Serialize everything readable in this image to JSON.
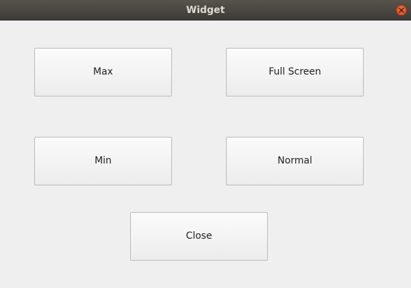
{
  "window": {
    "title": "Widget",
    "close_icon": "close-icon"
  },
  "buttons": {
    "max": "Max",
    "full_screen": "Full Screen",
    "min": "Min",
    "normal": "Normal",
    "close": "Close"
  }
}
